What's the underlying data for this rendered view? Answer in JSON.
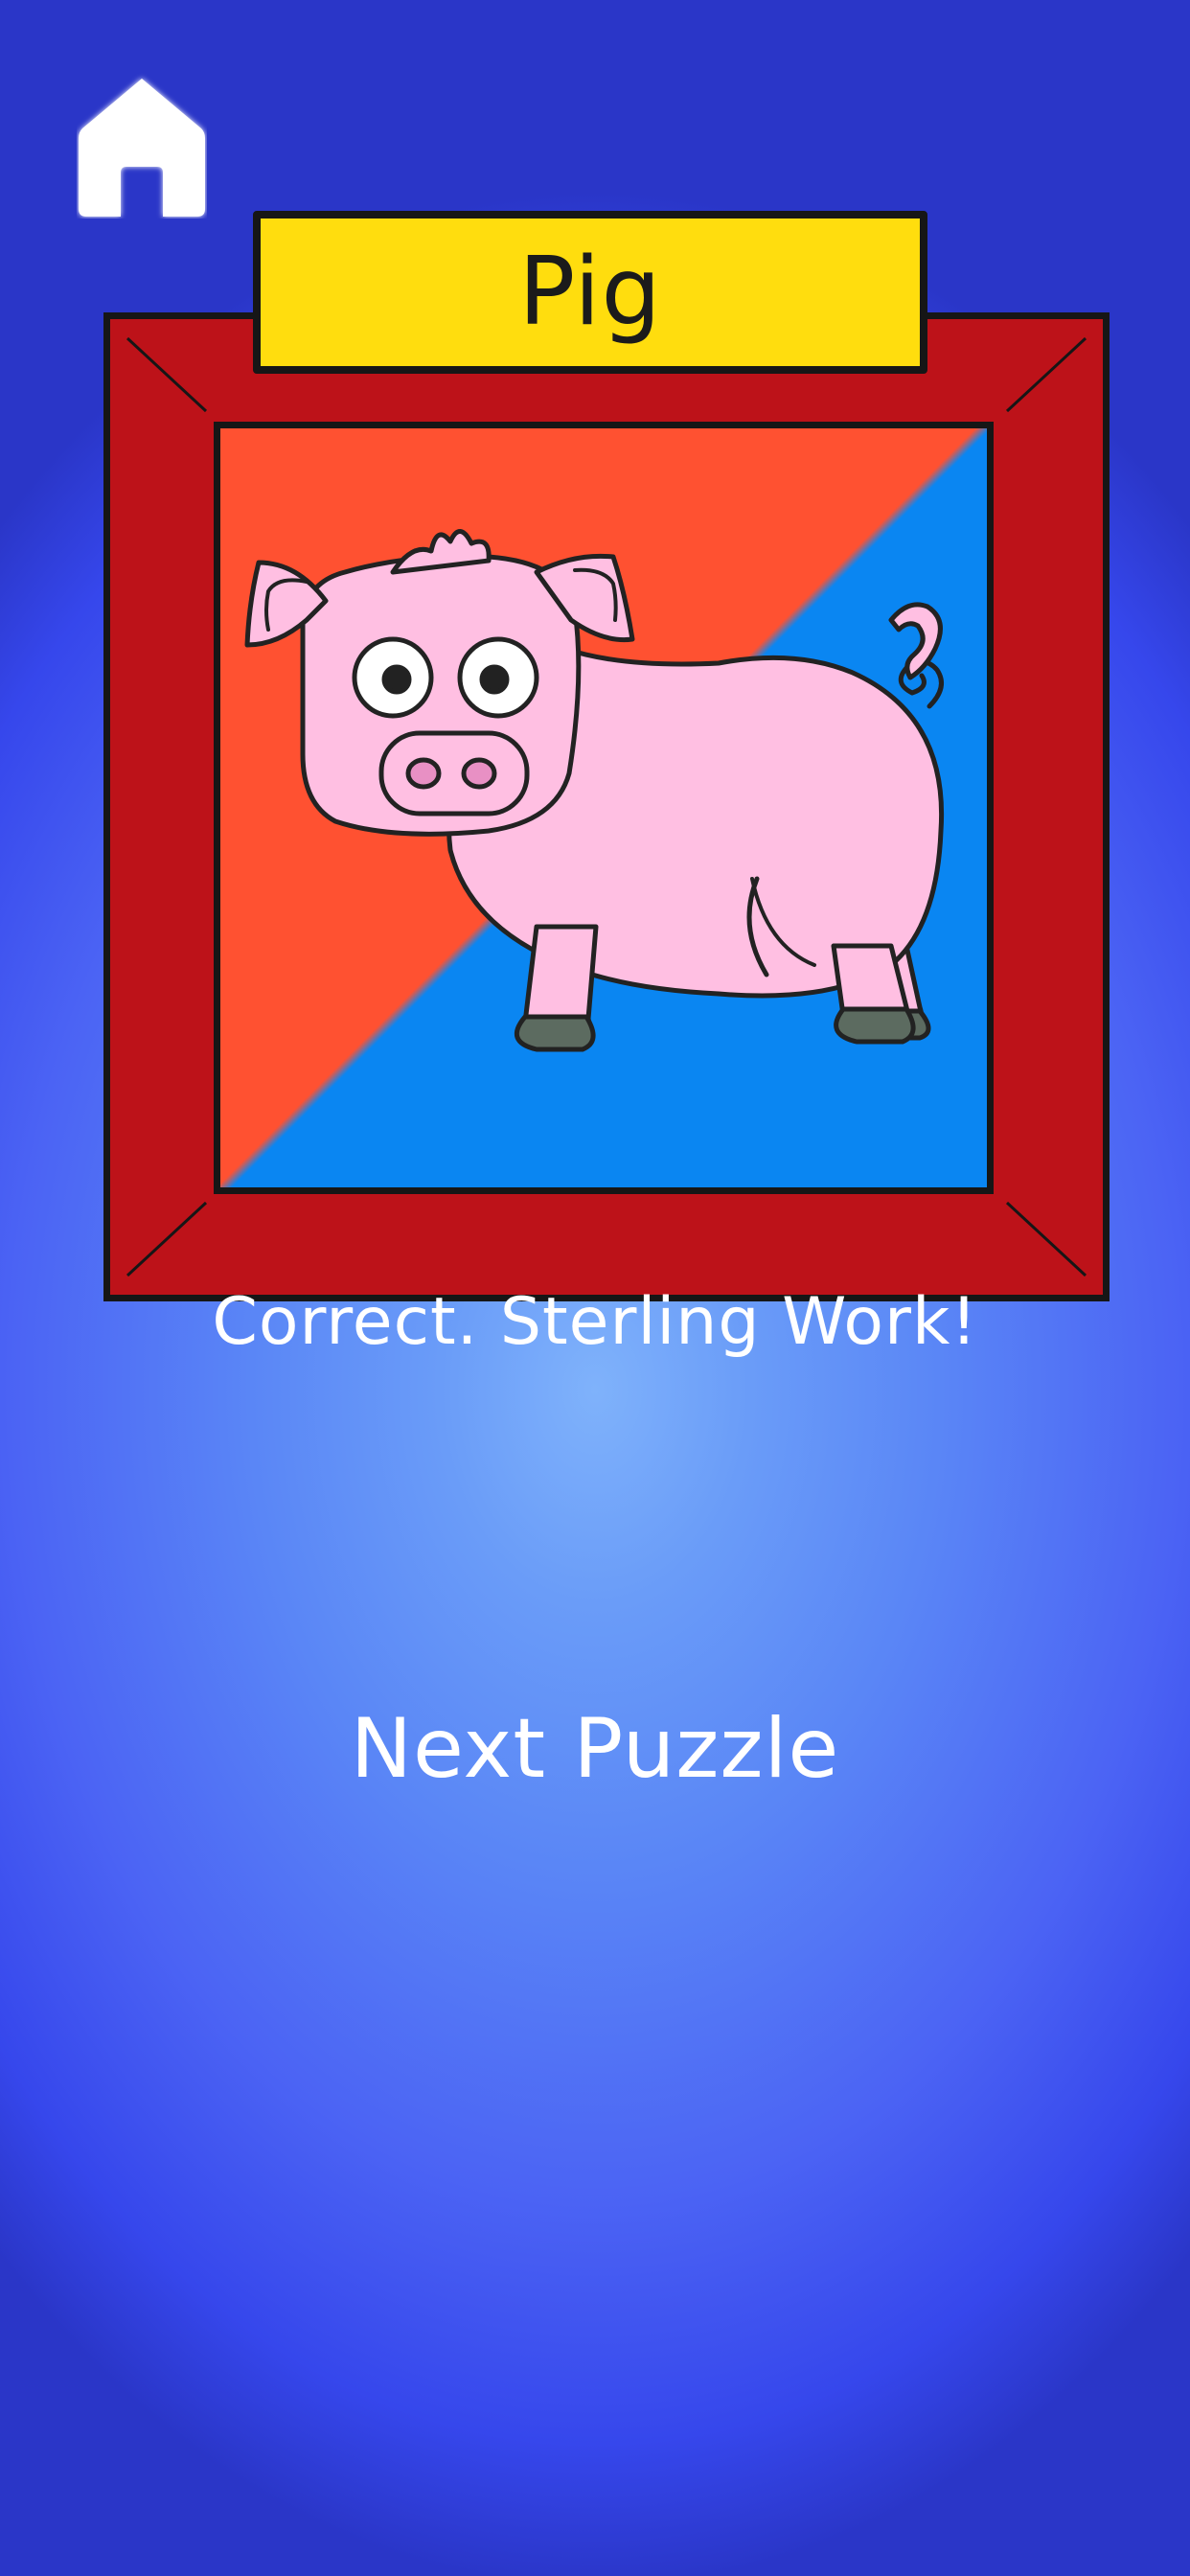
{
  "header": {
    "home_icon": "home-icon"
  },
  "puzzle": {
    "title": "Pig",
    "image_subject": "pig",
    "colors": {
      "frame": "#bd1219",
      "plate": "#ffdd0e",
      "background_top_left": "#ff5131",
      "background_bottom_right": "#0a86f2",
      "pig_body": "#ffbfe2"
    }
  },
  "result": {
    "message": "Correct. Sterling Work!"
  },
  "actions": {
    "next_label": "Next Puzzle"
  }
}
